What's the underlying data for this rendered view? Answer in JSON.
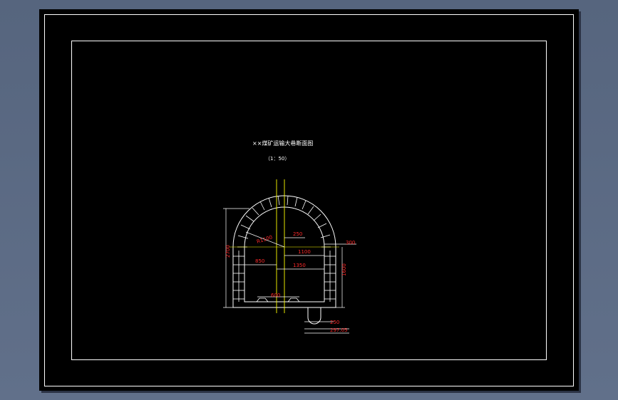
{
  "drawing": {
    "title": "××煤矿运输大巷断面图",
    "scale": "（1：50）"
  },
  "dimensions": {
    "height_left": "2700",
    "radius": "R1100",
    "d250_top": "250",
    "d1100": "1100",
    "d300": "300",
    "d850": "850",
    "d1350": "1350",
    "height_right": "1600",
    "d600": "600",
    "d250_bottom": "250",
    "d297": "297.05"
  },
  "colors": {
    "background": "#000000",
    "frame": "#ffffff",
    "dimension": "#ff2a2a",
    "centerline": "#ffff00"
  }
}
